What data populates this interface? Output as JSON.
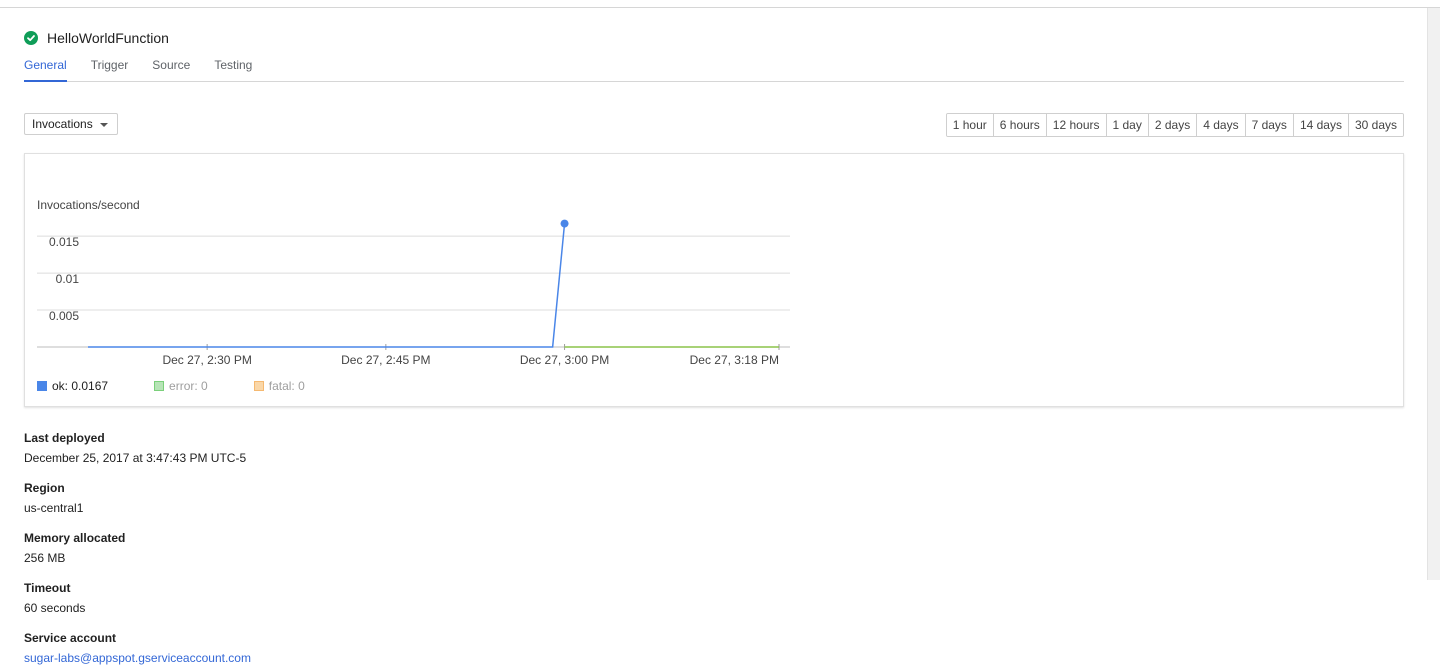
{
  "function": {
    "name": "HelloWorldFunction",
    "status": "ok",
    "status_color": "#0f9d58"
  },
  "tabs": [
    {
      "label": "General",
      "active": true
    },
    {
      "label": "Trigger",
      "active": false
    },
    {
      "label": "Source",
      "active": false
    },
    {
      "label": "Testing",
      "active": false
    }
  ],
  "metric_select": {
    "value": "Invocations",
    "icon": "caret-down-icon"
  },
  "time_ranges": [
    "1 hour",
    "6 hours",
    "12 hours",
    "1 day",
    "2 days",
    "4 days",
    "7 days",
    "14 days",
    "30 days"
  ],
  "chart_data": {
    "type": "line",
    "ylabel": "Invocations/second",
    "ylim": [
      0,
      0.018
    ],
    "yticks": [
      0.005,
      0.01,
      0.015
    ],
    "ytick_labels": [
      "0.005",
      "0.01",
      "0.015"
    ],
    "x_tick_labels": [
      "Dec 27, 2:30 PM",
      "Dec 27, 2:45 PM",
      "Dec 27, 3:00 PM",
      "Dec 27, 3:18 PM"
    ],
    "grid": true,
    "series": [
      {
        "name": "ok",
        "color": "#4a86e8",
        "points": [
          {
            "x": "Dec 27, 2:20 PM",
            "y": 0
          },
          {
            "x": "Dec 27, 2:59 PM",
            "y": 0
          },
          {
            "x": "Dec 27, 3:00 PM",
            "y": 0.0167
          }
        ]
      },
      {
        "name": "error",
        "color": "#8bc34a",
        "points": [
          {
            "x": "Dec 27, 3:00 PM",
            "y": 0
          },
          {
            "x": "Dec 27, 3:18 PM",
            "y": 0
          }
        ]
      }
    ],
    "legend": [
      {
        "label": "ok: 0.0167",
        "color": "#4a86e8",
        "fill": "#4a86e8",
        "text_color": "#212121"
      },
      {
        "label": "error: 0",
        "color": "#7bd07b",
        "fill": "#b7e4b7",
        "text_color": "#9e9e9e"
      },
      {
        "label": "fatal: 0",
        "color": "#f5b971",
        "fill": "#fad7a8",
        "text_color": "#9e9e9e"
      }
    ]
  },
  "details": {
    "last_deployed_label": "Last deployed",
    "last_deployed": "December 25, 2017 at 3:47:43 PM UTC-5",
    "region_label": "Region",
    "region": "us-central1",
    "memory_label": "Memory allocated",
    "memory": "256 MB",
    "timeout_label": "Timeout",
    "timeout": "60 seconds",
    "service_account_label": "Service account",
    "service_account": "sugar-labs@appspot.gserviceaccount.com"
  }
}
